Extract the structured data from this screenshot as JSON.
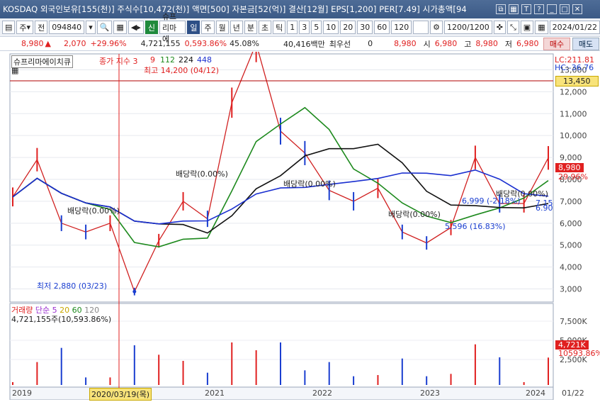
{
  "window": {
    "title": "KOSDAQ 외국인보유[155(천)] 주식수[10,472(천)] 액면[500] 자본금[52(억)] 결산[12월] EPS[1,200] PER[7.49] 시가총액[94"
  },
  "toolbar": {
    "market_select": "주",
    "prev_label": "전",
    "stock_code": "094840",
    "new_badge": "신",
    "stock_name": "슈프리마에",
    "period_tabs": [
      "일",
      "주",
      "월",
      "년",
      "분",
      "초",
      "틱"
    ],
    "interval_buttons": [
      "1",
      "3",
      "5",
      "10",
      "20",
      "30",
      "60",
      "120"
    ],
    "count_value": "1200/1200",
    "date_value": "2024/01/22"
  },
  "quote": {
    "price": "8,980",
    "change": "2,070",
    "change_pct": "+29.96%",
    "volume": "4,721,155",
    "volume_pct": "0,593.86%",
    "turnover": "45.08%",
    "trade_value": "40,416백만",
    "pref_label": "최우선",
    "pref_value": "0",
    "last": "8,980",
    "open_label": "시",
    "open_value": "6,980",
    "high_label": "고",
    "high_value": "8,980",
    "low_label": "저",
    "low_value": "6,980",
    "buy_label": "매수",
    "sell_label": "매도"
  },
  "price_panel": {
    "stock_label": "슈프리마에이치큐",
    "ma_legend": "종가 지수 3",
    "ma_periods": [
      "9",
      "112",
      "224",
      "448"
    ],
    "lc": "LC:211.81",
    "hc": "HC:-36.76",
    "high_marker": "최고 14,200 (04/12)",
    "low_marker": "최저 2,880 (03/23)",
    "current_price_tag": "8,980",
    "current_pct_tag": "29.96%",
    "ref_tag": "13,450",
    "annotations": [
      "배당락(0.00%)",
      "배당락(0.00%)",
      "배당락(0.00%)",
      "배당락(0.00%)",
      "배당락(0.00%)",
      "6,999 (-2.18%)",
      "5,596 (16.83%)",
      "7.15",
      "6.90"
    ],
    "y_ticks": [
      "13,000",
      "12,000",
      "11,000",
      "10,000",
      "9,000",
      "8,000",
      "7,000",
      "6,000",
      "5,000",
      "4,000",
      "3,000"
    ]
  },
  "volume_panel": {
    "legend_label": "거래량",
    "legend_mode": "단순",
    "legend_periods": [
      "5",
      "20",
      "60",
      "120"
    ],
    "summary": "4,721,155주(10,593.86%)",
    "y_ticks": [
      "7,500K",
      "5,000K",
      "2,500K"
    ],
    "current_tag": "4,721K",
    "current_pct_tag": "10593.86%"
  },
  "x_axis": {
    "ticks": [
      "2019",
      "2021",
      "2022",
      "2023",
      "2024"
    ],
    "highlight": "2020/03/19(목)",
    "right_label": "01/22"
  },
  "colors": {
    "up": "#e02020",
    "down": "#1a3ed0",
    "ma_green": "#1e8a1e",
    "ma_black": "#111111",
    "ma_blue": "#1a2fd0",
    "title_bar": "#3b5a86"
  },
  "chart_data": {
    "type": "line",
    "title": "",
    "x": [
      "2019-01",
      "2019-04",
      "2019-07",
      "2019-10",
      "2020-01",
      "2020-03",
      "2020-06",
      "2020-09",
      "2020-12",
      "2021-02",
      "2021-04",
      "2021-06",
      "2021-09",
      "2021-12",
      "2022-03",
      "2022-06",
      "2022-09",
      "2022-12",
      "2023-03",
      "2023-06",
      "2023-09",
      "2023-12",
      "2024-01"
    ],
    "series": [
      {
        "values": [
          7200,
          8900,
          6000,
          5600,
          6000,
          2880,
          5200,
          7000,
          6200,
          11500,
          14200,
          10200,
          9200,
          7500,
          7000,
          7600,
          5600,
          5100,
          5800,
          9000,
          6900,
          6900,
          8980
        ]
      }
    ],
    "ylim": [
      2500,
      13500
    ],
    "ylabel": "",
    "xlabel": ""
  }
}
